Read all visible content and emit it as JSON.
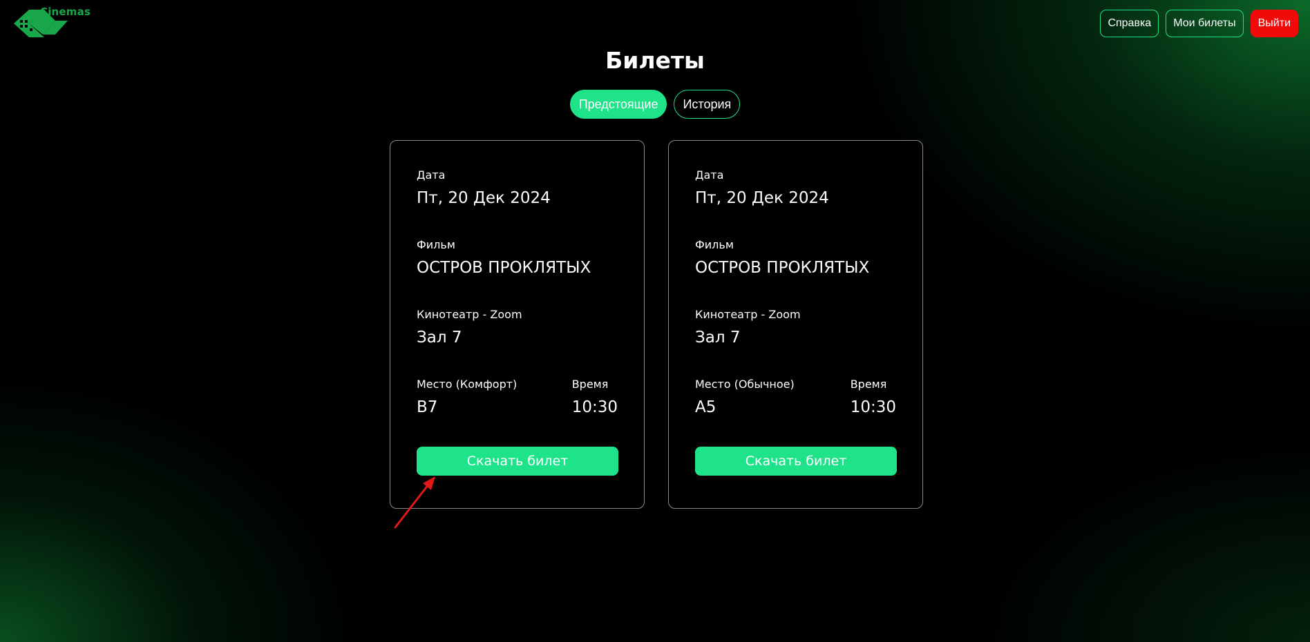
{
  "brand": {
    "name": "Cinemas",
    "accent": "#18a74a"
  },
  "nav": {
    "help_label": "Справка",
    "my_tickets_label": "Мои билеты",
    "logout_label": "Выйти"
  },
  "page": {
    "title": "Билеты"
  },
  "tabs": [
    {
      "label": "Предстоящие",
      "active": true
    },
    {
      "label": "История",
      "active": false
    }
  ],
  "tickets": [
    {
      "date_label": "Дата",
      "date": "Пт, 20 Дек 2024",
      "film_label": "Фильм",
      "film": "ОСТРОВ ПРОКЛЯТЫХ",
      "cinema_label": "Кинотеатр - Zoom",
      "hall": "Зал 7",
      "seat_label": "Место (Комфорт)",
      "seat": "B7",
      "time_label": "Время",
      "time": "10:30",
      "download_label": "Скачать билет"
    },
    {
      "date_label": "Дата",
      "date": "Пт, 20 Дек 2024",
      "film_label": "Фильм",
      "film": "ОСТРОВ ПРОКЛЯТЫХ",
      "cinema_label": "Кинотеатр - Zoom",
      "hall": "Зал 7",
      "seat_label": "Место (Обычное)",
      "seat": "A5",
      "time_label": "Время",
      "time": "10:30",
      "download_label": "Скачать билет"
    }
  ],
  "colors": {
    "primary": "#1ee389",
    "danger": "#f20a0a",
    "annotation": "#e01818"
  }
}
